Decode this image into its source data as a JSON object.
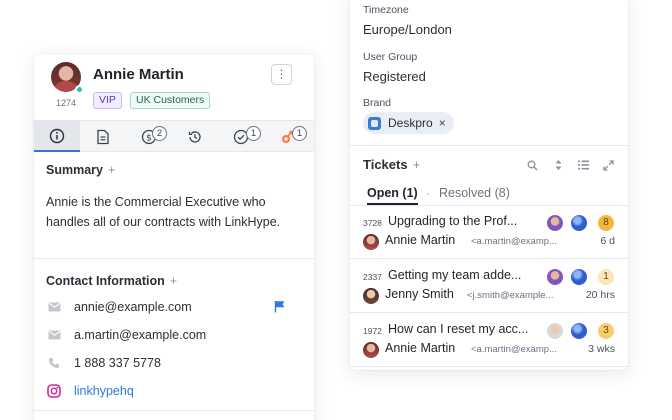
{
  "contact": {
    "name": "Annie Martin",
    "id": "1274",
    "tags": [
      "VIP",
      "UK Customers"
    ],
    "menu_icon": "more-vertical-icon"
  },
  "tabs": [
    {
      "icon": "info-icon",
      "badge": ""
    },
    {
      "icon": "document-icon",
      "badge": ""
    },
    {
      "icon": "billing-icon",
      "badge": "2"
    },
    {
      "icon": "history-icon",
      "badge": ""
    },
    {
      "icon": "tasks-check-icon",
      "badge": "1"
    },
    {
      "icon": "hubspot-icon",
      "badge": "1"
    }
  ],
  "summary": {
    "title": "Summary",
    "plus": "+",
    "text": "Annie is the Commercial Executive who handles all of our contracts with LinkHype."
  },
  "contact_info": {
    "title": "Contact Information",
    "plus": "+",
    "email_primary": "annie@example.com",
    "email_secondary": "a.martin@example.com",
    "phone": "1 888 337 5778",
    "instagram": "linkhypehq"
  },
  "details": {
    "timezone_label": "Timezone",
    "timezone_value": "Europe/London",
    "usergroup_label": "User Group",
    "usergroup_value": "Registered",
    "brand_label": "Brand",
    "brand_value": "Deskpro",
    "brand_remove": "×"
  },
  "tickets": {
    "title": "Tickets",
    "plus": "+",
    "tab_open": "Open (1)",
    "tab_separator": "·",
    "tab_resolved": "Resolved (8)",
    "items": [
      {
        "id": "3728",
        "title": "Upgrading to the Prof...",
        "person": "Annie Martin",
        "email": "<a.martin@examp...",
        "age": "6 d",
        "count": "8",
        "count_color": "#f5b640"
      },
      {
        "id": "2337",
        "title": "Getting my team adde...",
        "person": "Jenny Smith",
        "email": "<j.smith@example...",
        "age": "20 hrs",
        "count": "1",
        "count_color": "#fbe7b8"
      },
      {
        "id": "1972",
        "title": "How can I reset my acc...",
        "person": "Annie Martin",
        "email": "<a.martin@examp...",
        "age": "3 wks",
        "count": "3",
        "count_color": "#f7cd6a"
      }
    ]
  },
  "colors": {
    "accent": "#3a6fd8",
    "online": "#27c2a8",
    "hubspot": "#ff7a45",
    "link": "#2a7ae2"
  }
}
